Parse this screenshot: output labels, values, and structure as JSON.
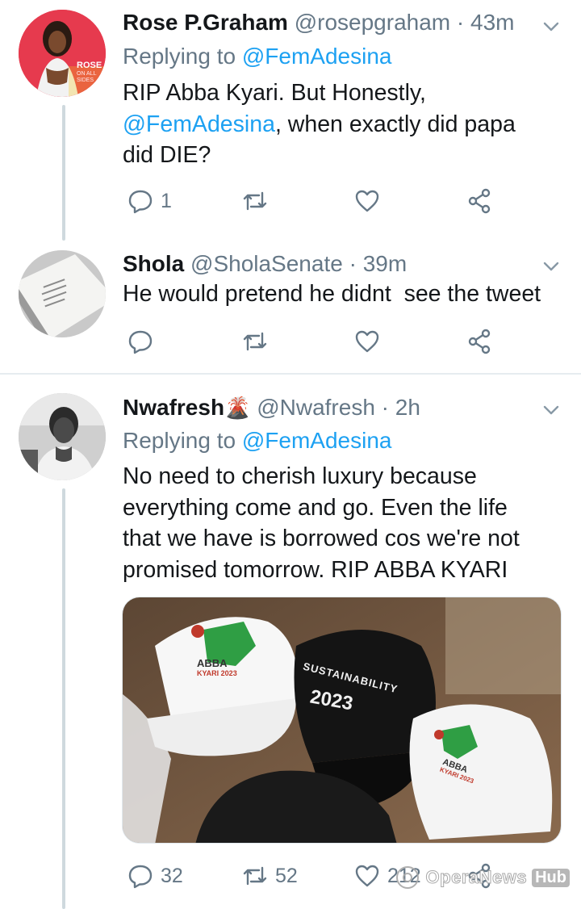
{
  "tweets": [
    {
      "name": "Rose P.Graham",
      "handle": "@rosepgraham",
      "separator": "·",
      "time": "43m",
      "replying_label": "Replying to",
      "replying_to": "@FemAdesina",
      "text_part1": "RIP Abba Kyari. But Honestly,",
      "text_mention": "@FemAdesina",
      "text_part2": ", when exactly did papa",
      "text_part3": "did DIE?",
      "avatar_text": "ROSE",
      "avatar_subtext": "ON ALL SIDES",
      "reply_count": "1",
      "retweet_count": "",
      "like_count": ""
    },
    {
      "name": "Shola",
      "handle": "@SholaSenate",
      "separator": "·",
      "time": "39m",
      "text": "He would pretend he didnt  see the tweet",
      "reply_count": "",
      "retweet_count": "",
      "like_count": ""
    },
    {
      "name": "Nwafresh",
      "name_emoji": "🌋",
      "handle": "@Nwafresh",
      "separator": "·",
      "time": "2h",
      "replying_label": "Replying to",
      "replying_to": "@FemAdesina",
      "text_line1": "No need to cherish luxury because",
      "text_line2": "everything come and go. Even the life",
      "text_line3": "that we have is borrowed cos we're not",
      "text_line4": "promised tomorrow. RIP ABBA KYARI",
      "media": {
        "cap1_text": "ABBA",
        "cap1_subtext": "KYARI 2023",
        "cap2_text": "SUSTAINABILITY",
        "cap2_year": "2023",
        "cap3_text": "ABBA",
        "cap3_subtext": "KYARI 2023"
      },
      "reply_count": "32",
      "retweet_count": "52",
      "like_count": "212"
    }
  ],
  "watermark": {
    "brand": "OperaNews",
    "hub": "Hub"
  },
  "colors": {
    "link": "#1da1f2",
    "secondary": "#657786",
    "divider": "#e6ecf0",
    "thread": "#cfd9de"
  },
  "icons": [
    "reply-icon",
    "retweet-icon",
    "like-icon",
    "share-icon",
    "chevron-down-icon",
    "volcano-emoji"
  ]
}
